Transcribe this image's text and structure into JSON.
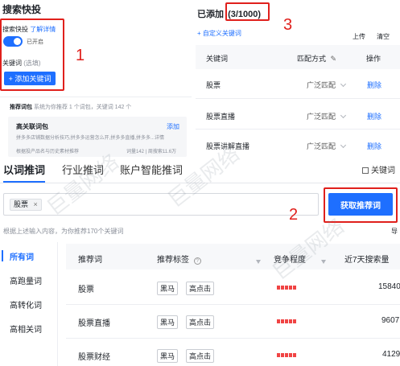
{
  "search_express": {
    "title": "搜索快投",
    "toggle_label": "搜索快投",
    "details_link": "了解详情",
    "toggle_state": "已开启",
    "keywords_label": "关键词",
    "keywords_optional": "(选填)",
    "add_keyword_button": "+ 添加关键词"
  },
  "word_pack": {
    "title": "推荐词包",
    "subtitle": "系统为你推荐 1 个词包，关键词 142 个",
    "pack_name": "高关联词包",
    "pack_add": "添加",
    "pack_desc": "拼多多店铺数据分析技巧,拼多多运营怎么开,拼多多直播,拼多多...详情",
    "pack_desc2": "根据投产品名与历史素材推荐",
    "pack_stats": "词量142 | 周搜索11.6万"
  },
  "added": {
    "title": "已添加",
    "count": "(3/1000)",
    "custom_link": "+ 自定义关键词",
    "upload": "上传",
    "clear": "清空",
    "columns": [
      "关键词",
      "匹配方式",
      "操作"
    ],
    "rows": [
      {
        "keyword": "股票",
        "match": "广泛匹配",
        "action": "删除"
      },
      {
        "keyword": "股票直播",
        "match": "广泛匹配",
        "action": "删除"
      },
      {
        "keyword": "股票讲解直播",
        "match": "广泛匹配",
        "action": "删除"
      }
    ]
  },
  "annotations": {
    "n1": "1",
    "n2": "2",
    "n3": "3"
  },
  "tabs": [
    "以词推词",
    "行业推词",
    "账户智能推词"
  ],
  "keyword_button": "关键词",
  "input_chip": "股票",
  "get_recommend_button": "获取推荐词",
  "hint": "根据上述输入内容，为你推荐170个关键词",
  "hint_right": "导",
  "sidebar": [
    "所有词",
    "高跑量词",
    "高转化词",
    "高相关词"
  ],
  "table": {
    "headers": [
      "推荐词",
      "推荐标签",
      "竞争程度",
      "近7天搜索量"
    ],
    "rows": [
      {
        "word": "股票",
        "tags": [
          "黑马",
          "高点击"
        ],
        "competition": 5,
        "volume": "15840"
      },
      {
        "word": "股票直播",
        "tags": [
          "黑马",
          "高点击"
        ],
        "competition": 5,
        "volume": "9607"
      },
      {
        "word": "股票财经",
        "tags": [
          "黑马",
          "高点击"
        ],
        "competition": 5,
        "volume": "4129"
      }
    ]
  },
  "watermark": "巨量网络",
  "colors": {
    "accent": "#1e6fff",
    "annotation": "#e0201c",
    "competition": "#f04444"
  }
}
